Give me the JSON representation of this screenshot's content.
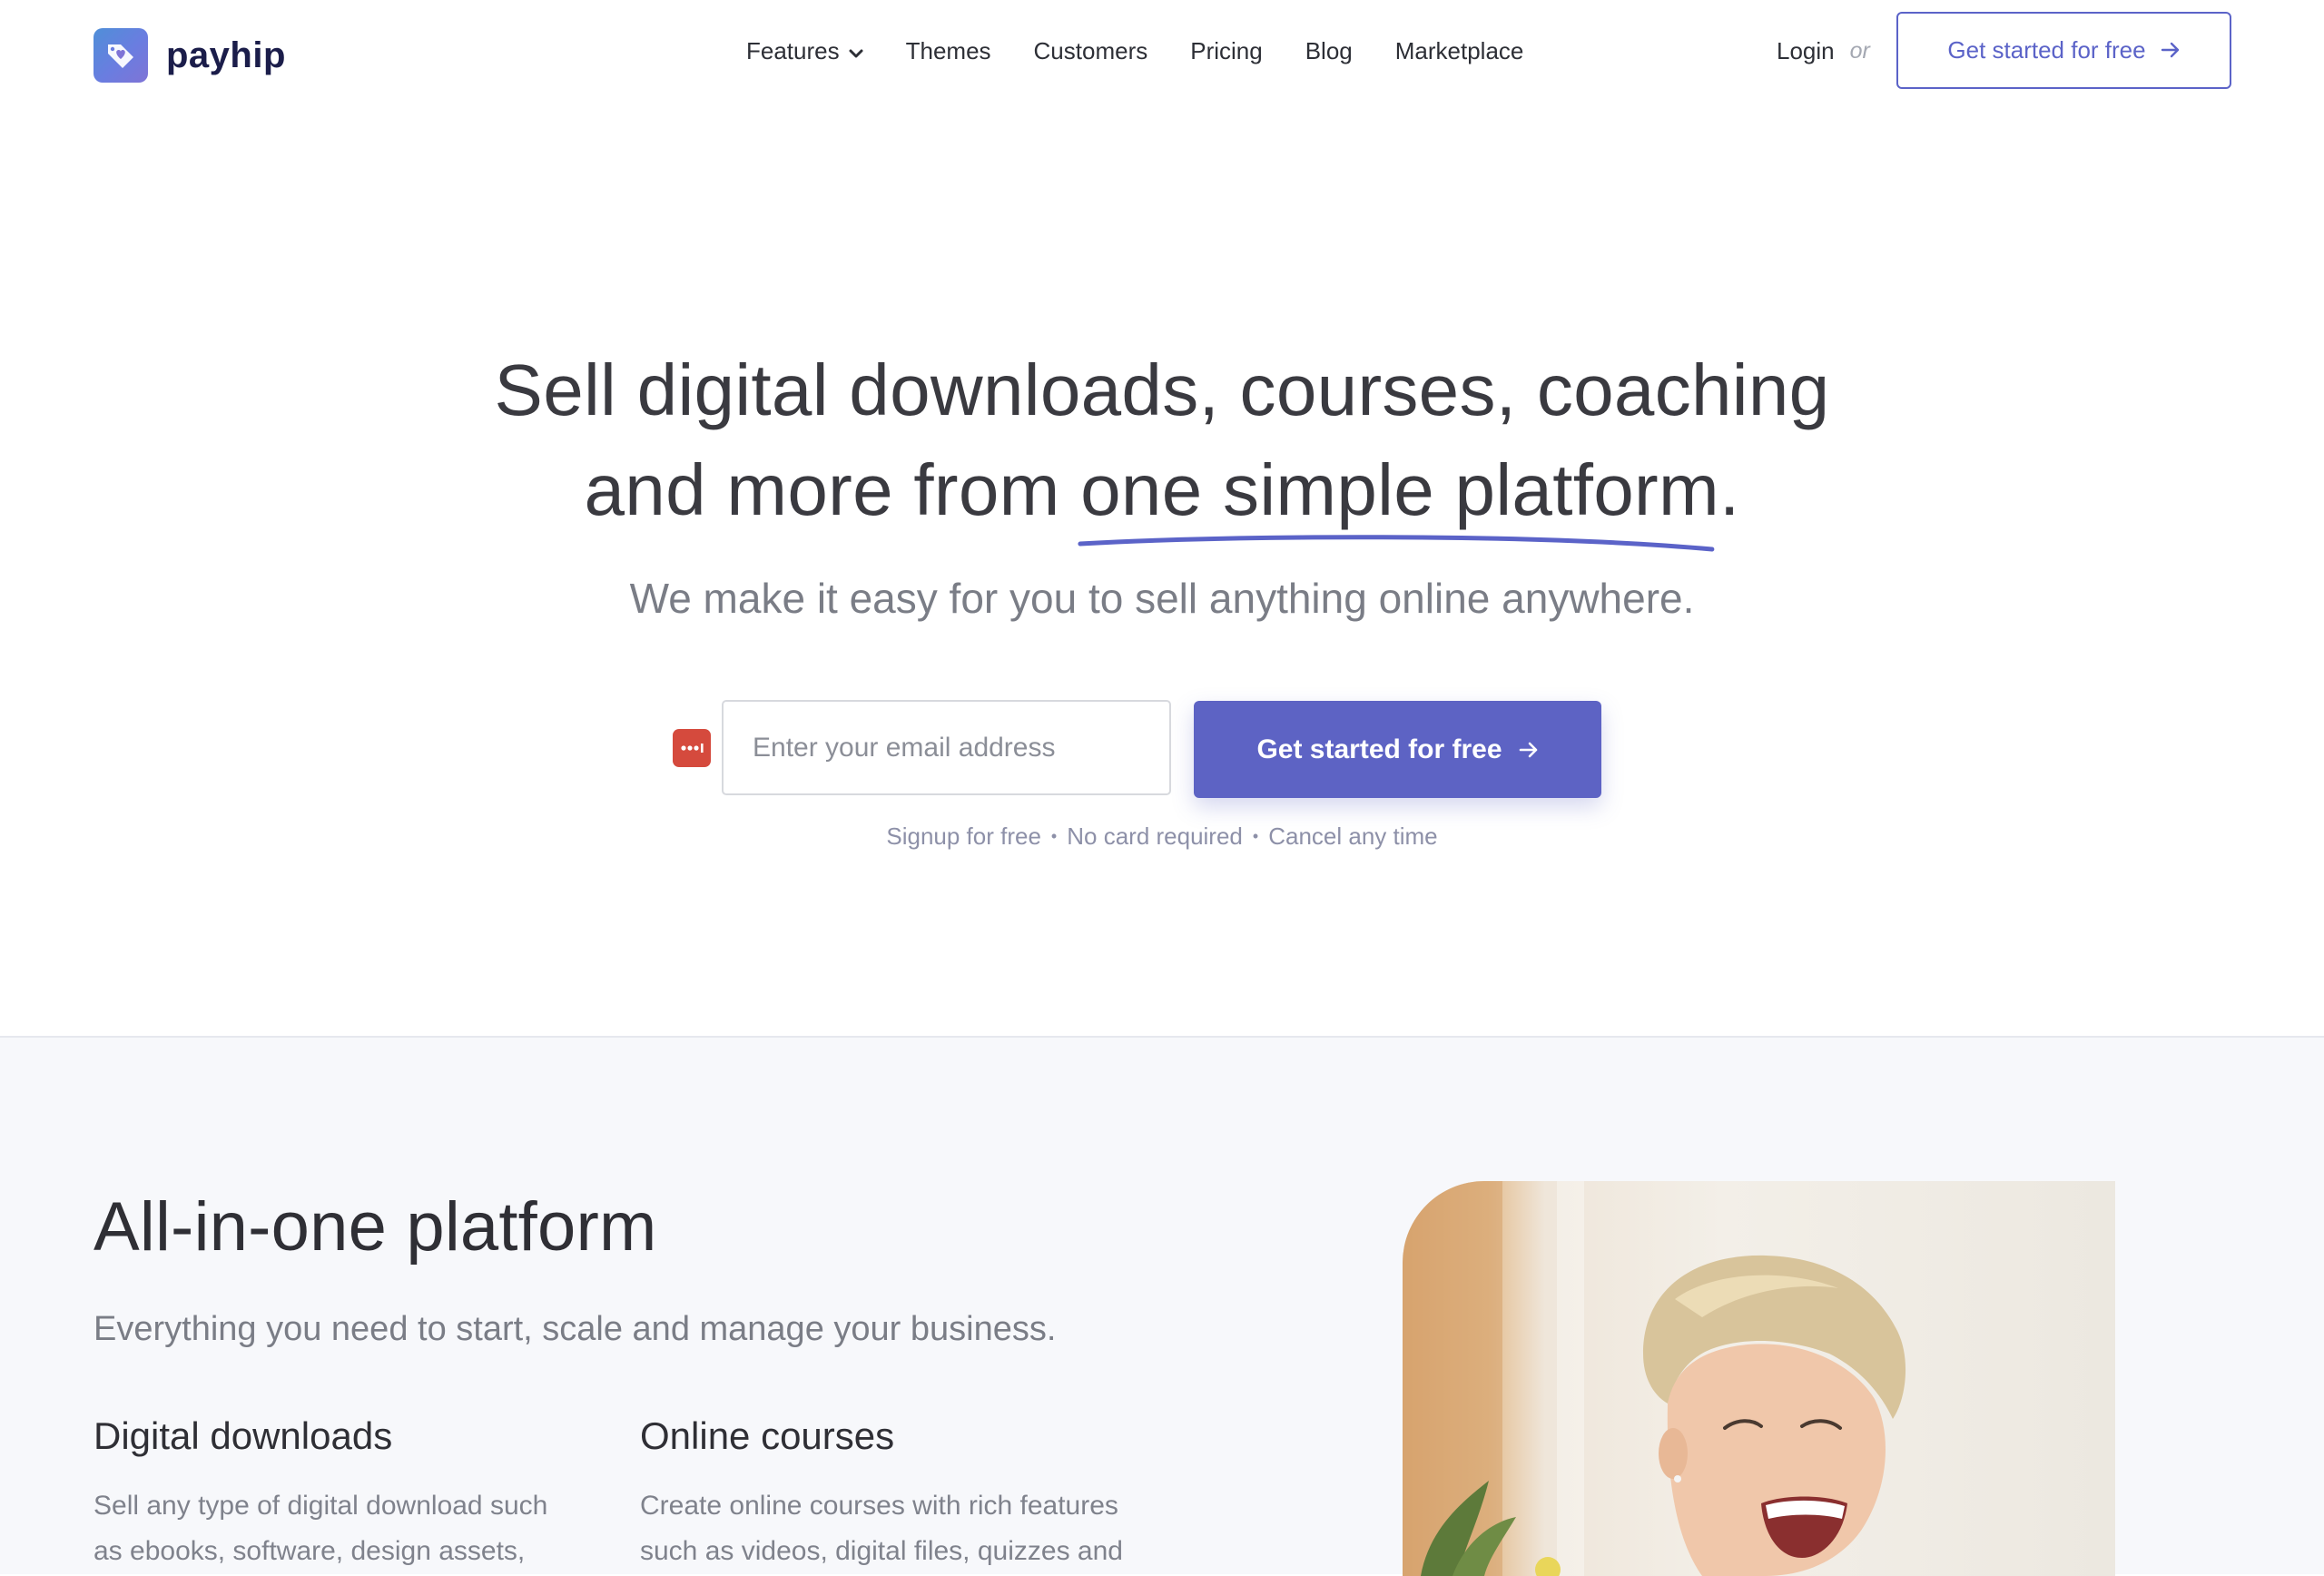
{
  "brand": {
    "name": "payhip",
    "accent_color": "#5b63c8"
  },
  "nav": {
    "items": [
      {
        "label": "Features",
        "has_dropdown": true
      },
      {
        "label": "Themes"
      },
      {
        "label": "Customers"
      },
      {
        "label": "Pricing"
      },
      {
        "label": "Blog"
      },
      {
        "label": "Marketplace"
      }
    ],
    "login_label": "Login",
    "or_label": "or",
    "cta_label": "Get started for free"
  },
  "hero": {
    "title_line1": "Sell digital downloads, courses, coaching",
    "title_line2_prefix": "and more from ",
    "title_line2_highlight": "one simple platform",
    "title_line2_suffix": ".",
    "subtitle": "We make it easy for you to sell anything online anywhere.",
    "email_placeholder": "Enter your email address",
    "email_value": "",
    "cta_label": "Get started for free",
    "perks": [
      "Signup for free",
      "No card required",
      "Cancel any time"
    ]
  },
  "platform": {
    "title": "All-in-one platform",
    "subtitle": "Everything you need to start, scale and manage your business.",
    "features": [
      {
        "title": "Digital downloads",
        "text": "Sell any type of digital download such as ebooks, software, design assets,"
      },
      {
        "title": "Online courses",
        "text": "Create online courses with rich features such as videos, digital files, quizzes and"
      }
    ]
  },
  "icons": {
    "logo": "tag-heart-icon",
    "dropdown": "chevron-down-icon",
    "arrow": "arrow-right-icon",
    "password_manager": "password-manager-icon"
  }
}
